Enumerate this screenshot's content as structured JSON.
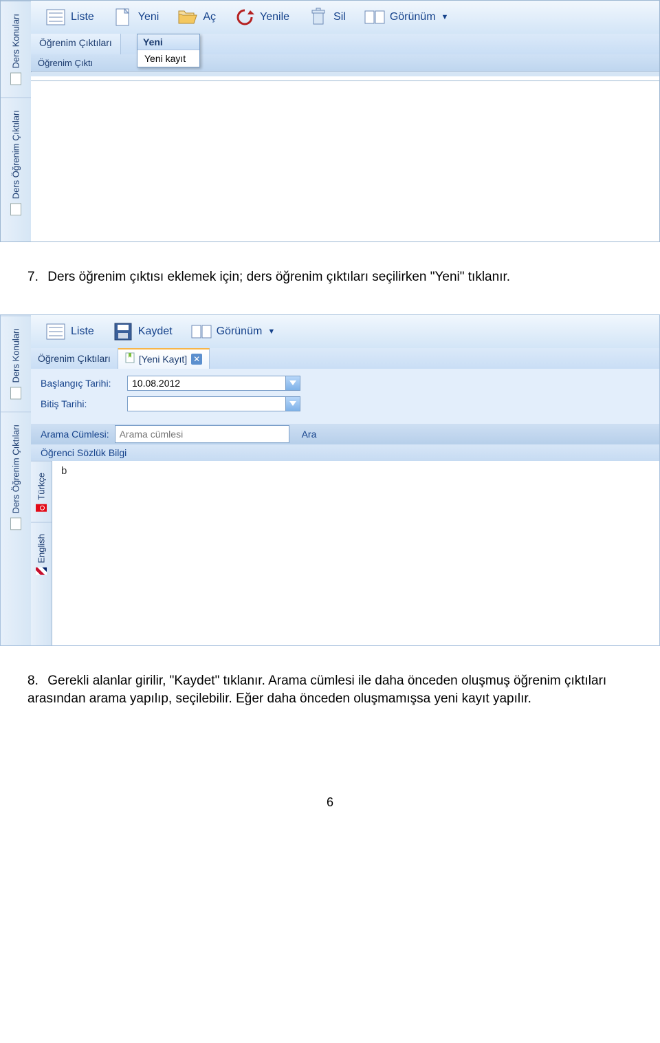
{
  "screenshot1": {
    "left_tabs": [
      "Ders Konuları",
      "Ders Öğrenim Çıktıları"
    ],
    "toolbar": {
      "liste": "Liste",
      "yeni": "Yeni",
      "ac": "Aç",
      "yenile": "Yenile",
      "sil": "Sil",
      "gorunum": "Görünüm"
    },
    "subtab": "Öğrenim Çıktıları",
    "second_row": "Öğrenim Çıktı",
    "dropdown": {
      "head": "Yeni",
      "item": "Yeni kayıt"
    }
  },
  "instruction7": {
    "num": "7.",
    "text": "Ders öğrenim çıktısı eklemek için; ders öğrenim çıktıları seçilirken \"Yeni\" tıklanır."
  },
  "screenshot2": {
    "left_tabs": [
      "Ders Konuları",
      "Ders Öğrenim Çıktıları"
    ],
    "toolbar": {
      "liste": "Liste",
      "kaydet": "Kaydet",
      "gorunum": "Görünüm"
    },
    "tabs": {
      "t1": "Öğrenim Çıktıları",
      "t2": "[Yeni Kayıt]"
    },
    "form": {
      "baslangic_label": "Başlangıç Tarihi:",
      "baslangic_value": "10.08.2012",
      "bitis_label": "Bitiş Tarihi:",
      "bitis_value": ""
    },
    "search": {
      "label": "Arama Cümlesi:",
      "placeholder": "Arama cümlesi",
      "button": "Ara"
    },
    "header_row": "Öğrenci Sözlük Bilgi",
    "lang_tabs": [
      "Türkçe",
      "English"
    ],
    "content_text": "b"
  },
  "instruction8": {
    "num": "8.",
    "text": "Gerekli alanlar girilir, \"Kaydet\" tıklanır. Arama cümlesi ile daha önceden oluşmuş öğrenim çıktıları arasından arama yapılıp, seçilebilir. Eğer daha önceden oluşmamışsa yeni kayıt yapılır."
  },
  "page_number": "6"
}
